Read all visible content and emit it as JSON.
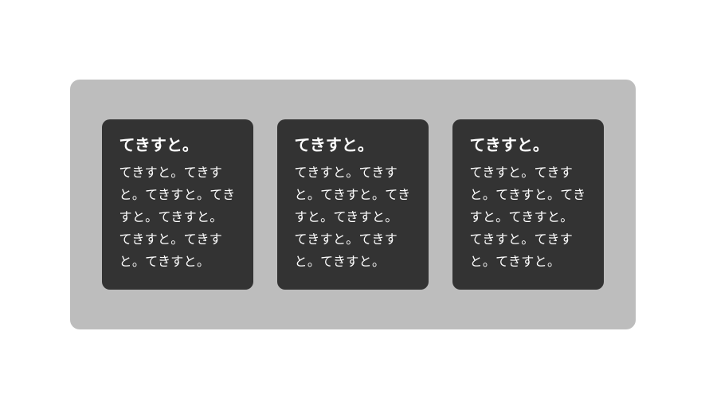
{
  "cards": [
    {
      "title": "てきすと。",
      "body": "てきすと。てきすと。てきすと。てきすと。てきすと。てきすと。てきすと。てきすと。"
    },
    {
      "title": "てきすと。",
      "body": "てきすと。てきすと。てきすと。てきすと。てきすと。てきすと。てきすと。てきすと。"
    },
    {
      "title": "てきすと。",
      "body": "てきすと。てきすと。てきすと。てきすと。てきすと。てきすと。てきすと。てきすと。"
    }
  ]
}
